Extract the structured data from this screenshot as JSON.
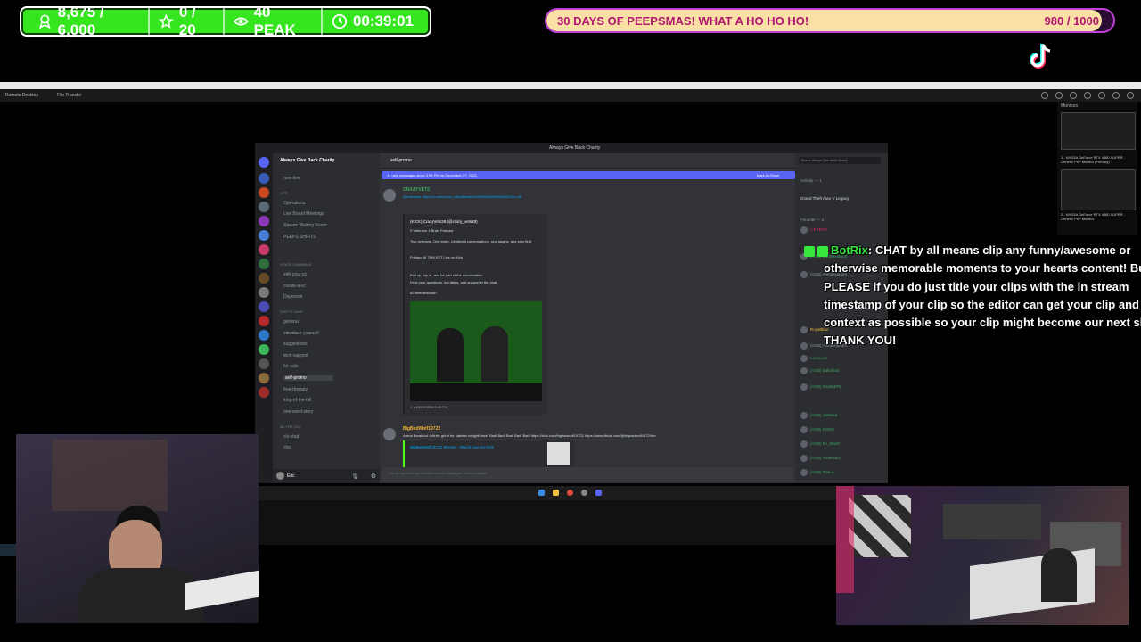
{
  "stats_bar": {
    "followers": "8,675 / 6,000",
    "subs": "0 / 20",
    "peak": "40 PEAK",
    "timer": "00:39:01"
  },
  "goal_bar": {
    "title": "30 DAYS OF PEEPSMAS! WHAT A HO HO HO!",
    "count": "980 / 1000",
    "progress": 0.98
  },
  "remote_desktop": {
    "tabs": [
      "Remote Desktop",
      "File Transfer"
    ],
    "monitors_title": "Monitors",
    "monitor_labels": [
      "1 - NVIDIA GeForce RTX 4080 SUPER - Generic PnP Monitor (Primary)",
      "2 - NVIDIA GeForce RTX 4080 SUPER - Generic PnP Monitor"
    ]
  },
  "discord": {
    "window_title": "Always Give Back Charity",
    "server_name": "Always Give Back Charity",
    "channel_header": "self-promo",
    "search_placeholder": "Search Always Give Back Charity",
    "new_messages_banner": "14 new messages since 3:56 PM on December 27, 2023",
    "mark_as_read": "Mark As Read",
    "channels": [
      {
        "name": "now-live",
        "type": "text"
      },
      {
        "name": "OPS",
        "type": "category"
      },
      {
        "name": "Operations",
        "type": "text"
      },
      {
        "name": "Live Board Meetings",
        "type": "voice"
      },
      {
        "name": "Stream Waiting Room",
        "type": "voice"
      },
      {
        "name": "PEEPS SHIRTS",
        "type": "text"
      },
      {
        "name": "VOICE CHANNELS",
        "type": "category"
      },
      {
        "name": "edit-your-vc",
        "type": "text"
      },
      {
        "name": "create-a-vc",
        "type": "text"
      },
      {
        "name": "Daymoon",
        "type": "voice"
      },
      {
        "name": "CHITTY CHAT",
        "type": "category"
      },
      {
        "name": "general",
        "type": "text"
      },
      {
        "name": "introduce-yourself",
        "type": "text"
      },
      {
        "name": "suggestions",
        "type": "text"
      },
      {
        "name": "tech-support",
        "type": "text"
      },
      {
        "name": "for-sale",
        "type": "text"
      },
      {
        "name": "self-promo",
        "type": "text",
        "active": true
      },
      {
        "name": "free-therapy",
        "type": "text"
      },
      {
        "name": "king-of-the-hill",
        "type": "text"
      },
      {
        "name": "one-word-story",
        "type": "text"
      },
      {
        "name": "ML / FR / DV",
        "type": "category"
      },
      {
        "name": "clv-chat",
        "type": "text"
      },
      {
        "name": "clvs",
        "type": "text"
      }
    ],
    "user_name": "Eric",
    "messages": [
      {
        "author": "CRAZYVETS",
        "text": "@everyone https://x.com/crazy_vets28/status/2000064384255642215s=46"
      },
      {
        "author": "BigBadWolf19722",
        "text": "Arena Breakout: Infinite grind for starters tonight! face! Bad! Bad! Bad! Bad! Bad! https://kick.com/bigbadwolf19722 https://www.tiktok.com/@bigbadwolf1972/live",
        "embed_title": "BigBadWolf19722 Stream - Watch Live on Kick"
      }
    ],
    "embed": {
      "title": "(KICK) CrazyVets28 (@crazy_vets28)",
      "line1": "2 Veterans 1 Brain Podcast",
      "line2": "Two veterans. One brain. Unfiltered conversations, real laughs, and zero fluff.",
      "line3": "Fridays @ 7PM EST Live on Kick",
      "line4": "Pull up, tap in, and be part of the conversation",
      "line5": "Drop your questions, hot takes, and support in the chat.",
      "hashtag": "#2VeteransBrain",
      "footer": "X • 12/27/2025 2:02 PM"
    },
    "input_placeholder": "You do not have permission to send messages in this channel.",
    "members_activity": "Activity — 1",
    "activity_game": "Grand Theft Auto V Legacy",
    "founder_section": "Founder — 1",
    "members": [
      "1 PEEPS",
      "(AGB) BorderedWolf",
      "(AGB) Ambassadors",
      "RoyalBlue",
      "(AGB) Ambassadors",
      "Local Lim",
      "(AGB) Bulletbait",
      "(AGB) DaddyDRL",
      "(AGB) Jarhead",
      "(AGB) KONG",
      "(AGB) Mr_MarM",
      "(AGB) RedBeard",
      "(AGB) TheLo..."
    ]
  },
  "chat_overlay": {
    "username": "BotRix",
    "lines": [
      ": CHAT by all means clip any funny/awesome or",
      "otherwise memorable moments to your hearts content! But",
      "PLEASE if you do just title your clips with the in stream",
      "timestamp of your clip so the editor can get your clip and as much",
      "context as possible so your clip might become our next short!",
      "THANK YOU!"
    ]
  },
  "colors": {
    "stats_green": "#35e61f",
    "goal_border": "#c040d8",
    "goal_fill": "#fbe0a5",
    "goal_text": "#b0176e",
    "discord_bg": "#313338",
    "discord_blurple": "#5865f2",
    "chat_user": "#37e83c"
  }
}
